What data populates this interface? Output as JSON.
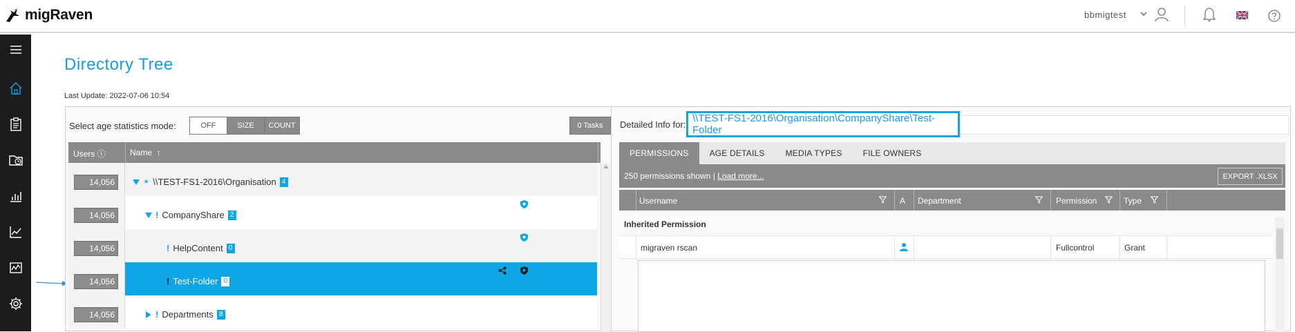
{
  "app": {
    "name": "migRaven",
    "user": "bbmigtest"
  },
  "colors": {
    "accent": "#1b9ae0",
    "selected": "#0ea5e9",
    "sidebar": "#1c1c1c",
    "header_gray": "#8a8a8a"
  },
  "page": {
    "title": "Directory Tree",
    "last_update": "Last Update: 2022-07-06 10:54"
  },
  "toolbar": {
    "age_label": "Select age statistics mode:",
    "modes": [
      {
        "label": "OFF",
        "active": true
      },
      {
        "label": "SIZE",
        "active": false
      },
      {
        "label": "COUNT",
        "active": false
      }
    ],
    "tasks": "0 Tasks"
  },
  "tree": {
    "columns": {
      "users": "Users",
      "name": "Name"
    },
    "rows": [
      {
        "users": "14,056",
        "label": "\\\\TEST-FS1-2016\\Organisation",
        "count": "4",
        "expander": "expanded",
        "marker": "star"
      },
      {
        "users": "14,056",
        "label": "CompanyShare",
        "count": "2",
        "expander": "expanded",
        "marker": "excl"
      },
      {
        "users": "14,056",
        "label": "HelpContent",
        "count": "0",
        "expander": "none",
        "marker": "excl"
      },
      {
        "users": "14,056",
        "label": "Test-Folder",
        "count": "0",
        "expander": "none",
        "marker": "excl",
        "selected": true
      },
      {
        "users": "14,056",
        "label": "Departments",
        "count": "8",
        "expander": "collapsed",
        "marker": "excl"
      }
    ]
  },
  "detail": {
    "label": "Detailed Info for:",
    "path": "\\\\TEST-FS1-2016\\Organisation\\CompanyShare\\Test-Folder",
    "tabs": [
      "PERMISSIONS",
      "AGE DETAILS",
      "MEDIA TYPES",
      "FILE OWNERS"
    ],
    "perm_count": "250 permissions shown |",
    "load_more": "Load more...",
    "export": "EXPORT .XLSX",
    "columns": {
      "username": "Username",
      "a": "A",
      "department": "Department",
      "permission": "Permission",
      "type": "Type"
    },
    "group": "Inherited Permission",
    "rows": [
      {
        "username": "migraven rscan",
        "department": "",
        "permission": "Fullcontrol",
        "type": "Grant"
      }
    ]
  },
  "icons": [
    "menu-icon",
    "home-icon",
    "clipboard-icon",
    "clock-folder-icon",
    "bar-chart-icon",
    "line-chart-icon",
    "activity-icon",
    "gear-icon",
    "user-icon",
    "bell-icon",
    "flag-icon",
    "help-icon"
  ]
}
